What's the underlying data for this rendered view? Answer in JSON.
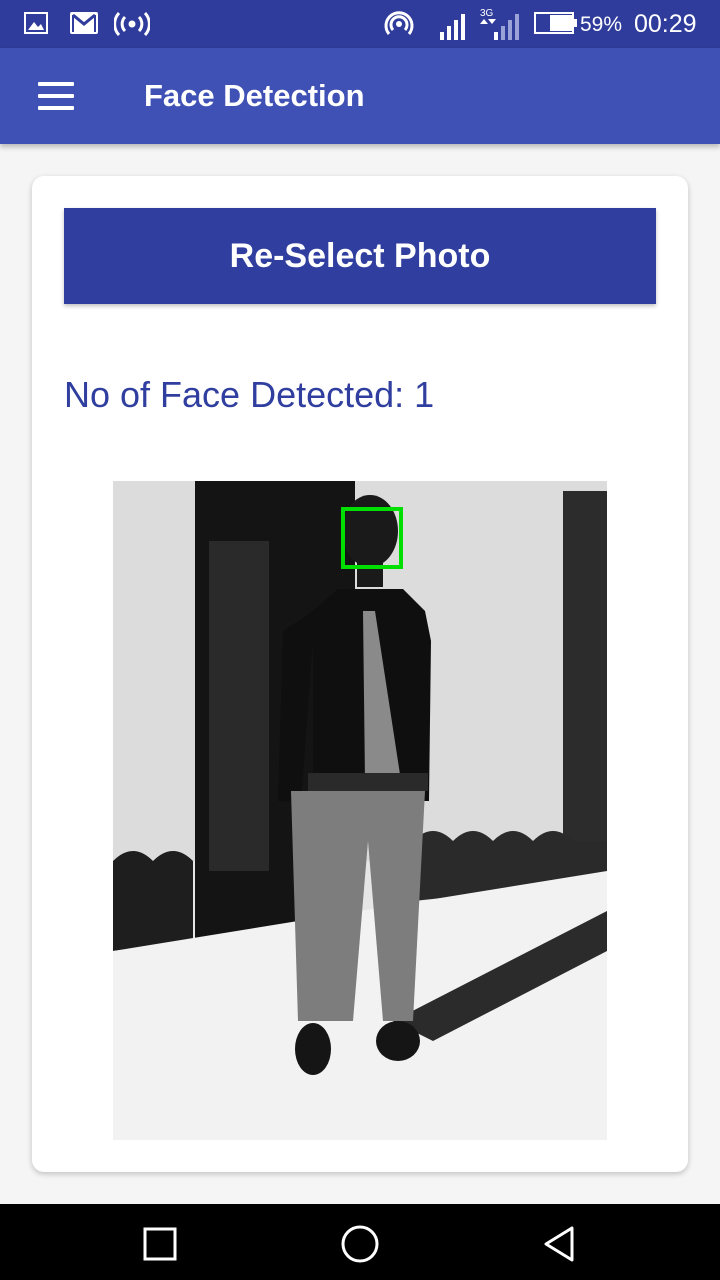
{
  "status_bar": {
    "battery_percent": "59%",
    "time": "00:29",
    "network_label": "3G",
    "icons": [
      "gallery-icon",
      "gmail-icon",
      "wireless-broadcast-icon",
      "hotspot-icon",
      "signal-icon",
      "signal-3g-icon",
      "battery-icon"
    ]
  },
  "app_bar": {
    "title": "Face Detection",
    "menu_icon": "hamburger-menu-icon"
  },
  "main": {
    "reselect_label": "Re-Select Photo",
    "face_count_label": "No of Face Detected: 1",
    "faces_detected": 1,
    "photo_description_icon": "photo-with-detected-face",
    "face_box_color": "#00e000"
  },
  "nav_bar": {
    "buttons": [
      "recent-apps-icon",
      "home-icon",
      "back-icon"
    ]
  },
  "colors": {
    "status_bar": "#2f3c9b",
    "app_bar": "#3f51b5",
    "accent": "#303f9f"
  }
}
